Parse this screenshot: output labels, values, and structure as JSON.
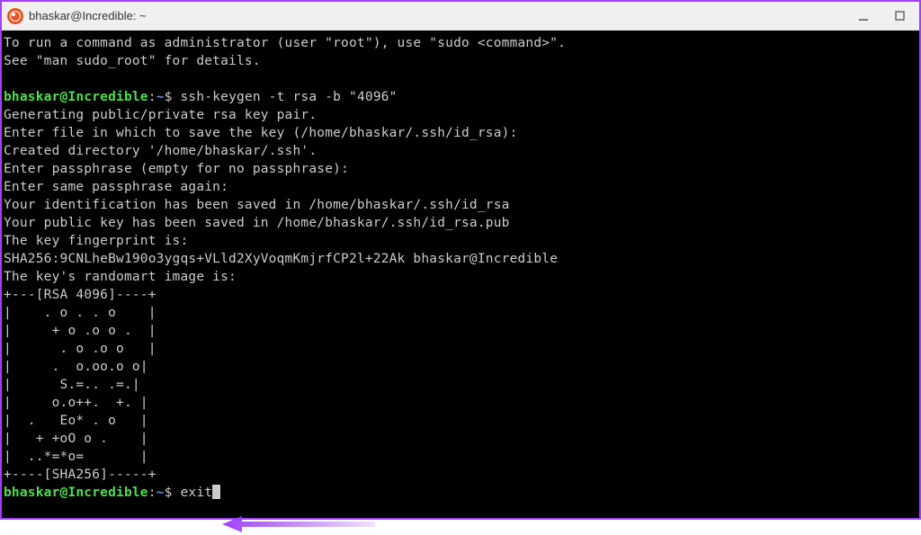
{
  "titlebar": {
    "title": "bhaskar@Incredible: ~"
  },
  "prompt": {
    "user_host": "bhaskar@Incredible",
    "path": "~",
    "dollar": "$"
  },
  "commands": {
    "cmd1": "ssh-keygen -t rsa -b \"4096\"",
    "cmd2": "exit"
  },
  "output": {
    "line1": "To run a command as administrator (user \"root\"), use \"sudo <command>\".",
    "line2": "See \"man sudo_root\" for details.",
    "gen1": "Generating public/private rsa key pair.",
    "gen2": "Enter file in which to save the key (/home/bhaskar/.ssh/id_rsa):",
    "gen3": "Created directory '/home/bhaskar/.ssh'.",
    "gen4": "Enter passphrase (empty for no passphrase):",
    "gen5": "Enter same passphrase again:",
    "gen6": "Your identification has been saved in /home/bhaskar/.ssh/id_rsa",
    "gen7": "Your public key has been saved in /home/bhaskar/.ssh/id_rsa.pub",
    "gen8": "The key fingerprint is:",
    "gen9": "SHA256:9CNLheBw190o3ygqs+VLld2XyVoqmKmjrfCP2l+22Ak bhaskar@Incredible",
    "gen10": "The key's randomart image is:",
    "art1": "+---[RSA 4096]----+",
    "art2": "|    . o . . o    |",
    "art3": "|     + o .o o .  |",
    "art4": "|      . o .o o   |",
    "art5": "|     .  o.oo.o o|",
    "art6": "|      S.=.. .=.|",
    "art7": "|     o.o++.  +. |",
    "art8": "|  .   Eo* . o   |",
    "art9": "|   + +oO o .    |",
    "art10": "|  ..*=*o=       |",
    "art11": "+----[SHA256]-----+"
  }
}
